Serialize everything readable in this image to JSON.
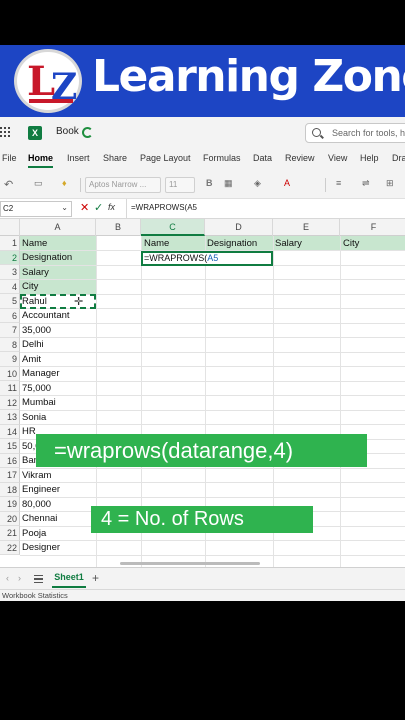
{
  "banner": {
    "title": "Learning Zone",
    "logo_letters": "LZ"
  },
  "titlebar": {
    "file_name": "Book",
    "search_placeholder": "Search for tools, he"
  },
  "ribbon_tabs": [
    "File",
    "Home",
    "Insert",
    "Share",
    "Page Layout",
    "Formulas",
    "Data",
    "Review",
    "View",
    "Help",
    "Dra"
  ],
  "active_tab": "Home",
  "toolbar": {
    "font_name": "Aptos Narrow ...",
    "font_size": "11",
    "bold": "B"
  },
  "formula_bar": {
    "name_box": "C2",
    "cancel": "✕",
    "enter": "✓",
    "fx": "fx",
    "formula": "=WRAPROWS(A5"
  },
  "columns": [
    "A",
    "B",
    "C",
    "D",
    "E",
    "F"
  ],
  "selected_column": "C",
  "rows": [
    "1",
    "2",
    "3",
    "4",
    "5",
    "6",
    "7",
    "8",
    "9",
    "10",
    "11",
    "12",
    "13",
    "14",
    "15",
    "16",
    "17",
    "18",
    "19",
    "20",
    "21",
    "22"
  ],
  "selected_row": "2",
  "column_a": [
    "Name",
    "Designation",
    "Salary",
    "City",
    "Rahul",
    "Accountant",
    "35,000",
    "Delhi",
    "Amit",
    "Manager",
    "75,000",
    "Mumbai",
    "Sonia",
    "HR",
    "50,0",
    "Ban",
    "Vikram",
    "Engineer",
    "80,000",
    "Chennai",
    "Pooja",
    "Designer"
  ],
  "header_row": {
    "c": "Name",
    "d": "Designation",
    "e": "Salary",
    "f": "City"
  },
  "editing_cell": {
    "prefix": "=WRAPROWS(",
    "ref": "A5"
  },
  "overlays": {
    "formula_hint": "=wraprows(datarange,4)",
    "rows_hint": "4 = No. of Rows"
  },
  "sheet_tab": "Sheet1",
  "add_sheet": "+",
  "status_bar": "Workbook Statistics",
  "colors": {
    "excel_green": "#107c41",
    "banner_blue": "#1d45c4",
    "highlight_green": "#c8e6cf",
    "overlay_green": "#2fb34f"
  }
}
